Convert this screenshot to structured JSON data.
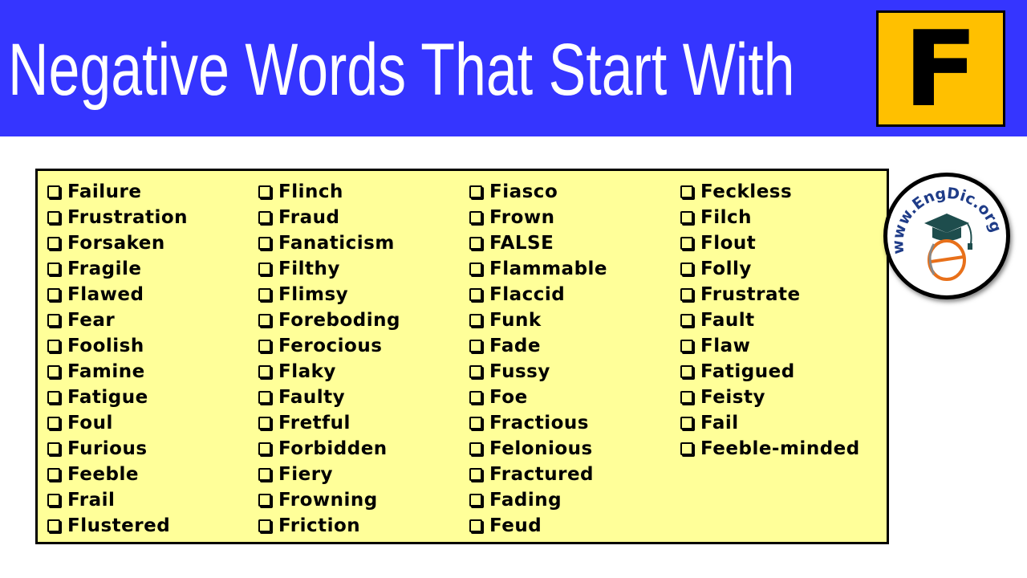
{
  "header": {
    "title": "Negative Words That Start With",
    "letter": "F",
    "colors": {
      "background": "#3535ff",
      "title": "#ffffff",
      "letter_box": "#ffc000"
    }
  },
  "panel": {
    "background": "#ffff99",
    "columns": [
      [
        "Failure",
        "Frustration",
        "Forsaken",
        "Fragile",
        "Flawed",
        "Fear",
        "Foolish",
        "Famine",
        "Fatigue",
        "Foul",
        "Furious",
        "Feeble",
        "Frail",
        "Flustered"
      ],
      [
        "Flinch",
        "Fraud",
        "Fanaticism",
        "Filthy",
        "Flimsy",
        "Foreboding",
        "Ferocious",
        "Flaky",
        "Faulty",
        "Fretful",
        "Forbidden",
        "Fiery",
        "Frowning",
        "Friction"
      ],
      [
        "Fiasco",
        "Frown",
        "FALSE",
        "Flammable",
        "Flaccid",
        "Funk",
        "Fade",
        "Fussy",
        "Foe",
        "Fractious",
        "Felonious",
        "Fractured",
        "Fading",
        "Feud"
      ],
      [
        "Feckless",
        "Filch",
        "Flout",
        "Folly",
        "Frustrate",
        "Fault",
        "Flaw",
        "Fatigued",
        "Feisty",
        "Fail",
        "Feeble-minded"
      ]
    ],
    "item_icon": "checkbox-icon"
  },
  "logo": {
    "text_top": "www.EngDic.org",
    "icon": "graduation-cap-icon",
    "letter": "e",
    "colors": {
      "text": "#1f3c88",
      "cap": "#1e4d4d",
      "letter": "#e8701a"
    }
  }
}
